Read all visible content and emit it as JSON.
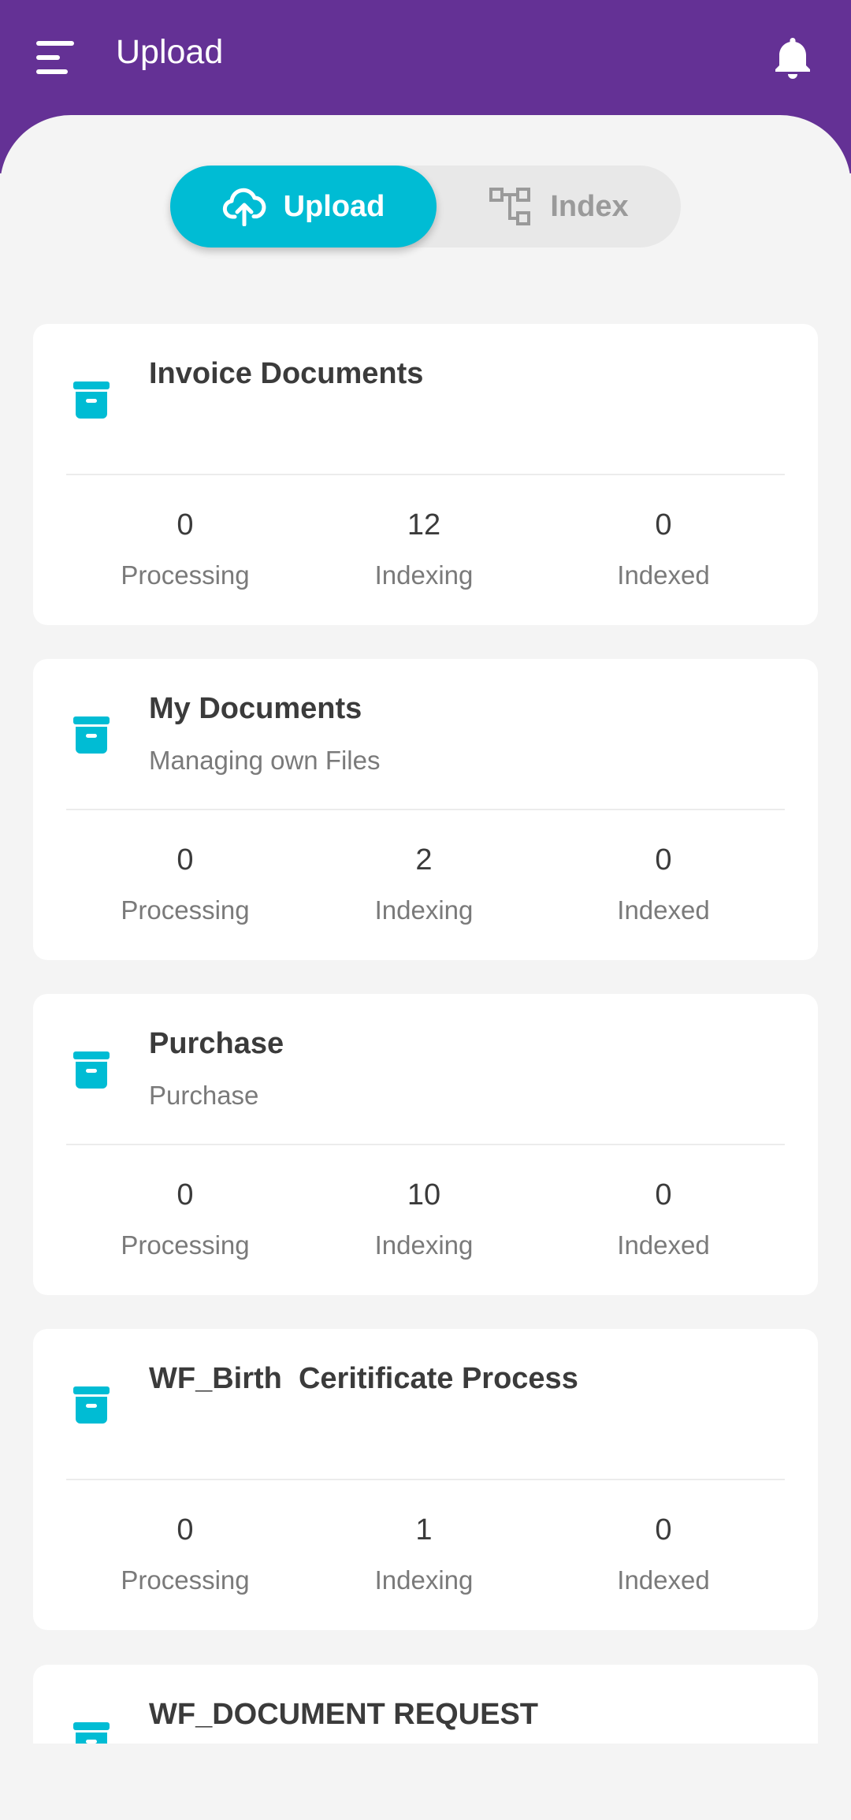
{
  "app_bar": {
    "title": "Upload",
    "menu_icon": "menu-icon",
    "notification_icon": "bell-icon",
    "background": "#643195"
  },
  "toggle": {
    "upload_label": "Upload",
    "index_label": "Index",
    "active": "Upload",
    "accent": "#00bcd4"
  },
  "cards": [
    {
      "title": "Invoice Documents",
      "subtitle": "",
      "processing": "0",
      "indexing": "12",
      "indexed": "0"
    },
    {
      "title": "My Documents",
      "subtitle": "Managing own Files",
      "processing": "0",
      "indexing": "2",
      "indexed": "0"
    },
    {
      "title": "Purchase",
      "subtitle": "Purchase",
      "processing": "0",
      "indexing": "10",
      "indexed": "0"
    },
    {
      "title": "WF_Birth  Ceritificate Process",
      "subtitle": "",
      "processing": "0",
      "indexing": "1",
      "indexed": "0"
    },
    {
      "title": "WF_DOCUMENT REQUEST",
      "subtitle": ""
    }
  ],
  "stat_labels": {
    "processing": "Processing",
    "indexing": "Indexing",
    "indexed": "Indexed"
  }
}
